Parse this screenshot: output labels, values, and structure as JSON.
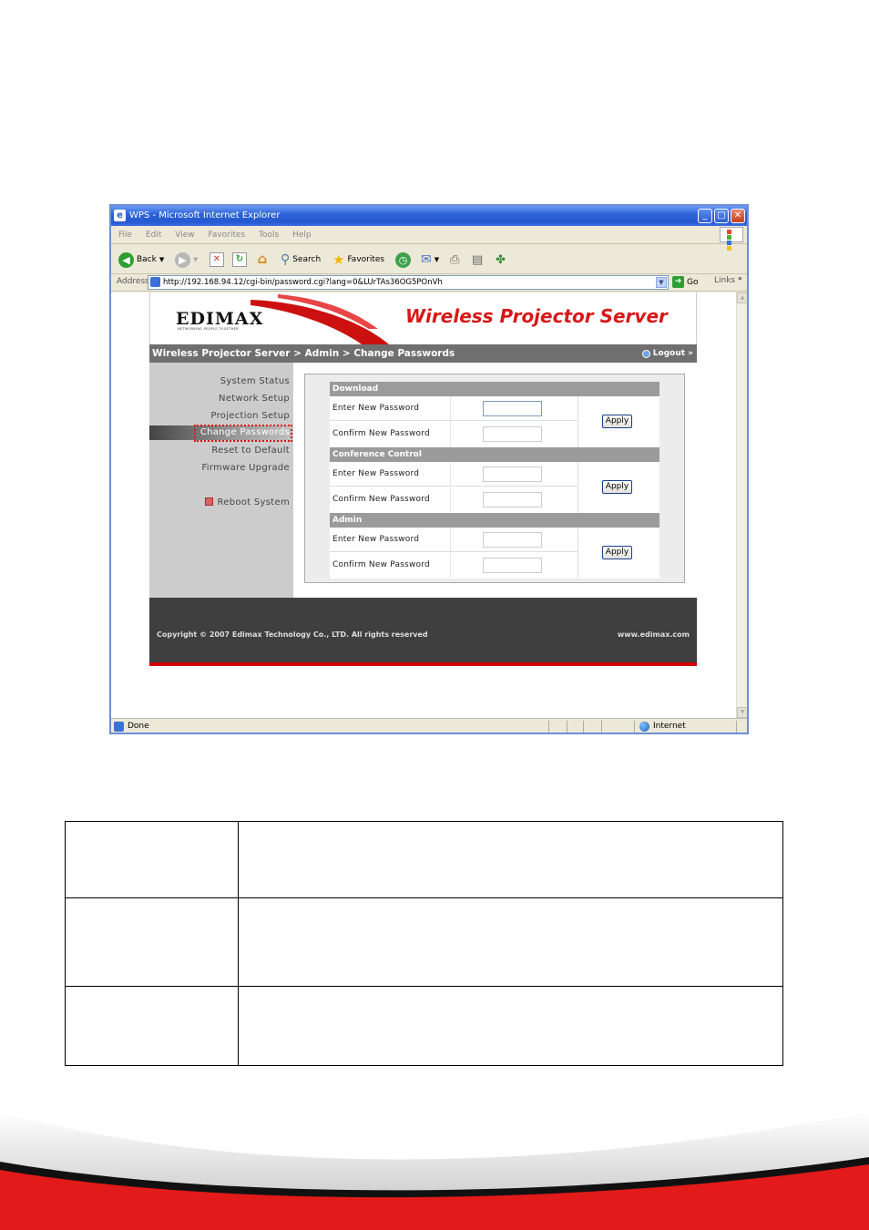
{
  "window": {
    "title": "WPS - Microsoft Internet Explorer",
    "controls": {
      "minimize": "_",
      "maximize": "□",
      "close": "✕"
    }
  },
  "menu": [
    "File",
    "Edit",
    "View",
    "Favorites",
    "Tools",
    "Help"
  ],
  "toolbar": {
    "back": "Back",
    "search": "Search",
    "favorites": "Favorites"
  },
  "address": {
    "label": "Address",
    "url": "http://192.168.94.12/cgi-bin/password.cgi?lang=0&LUrTAs36OG5POnVh",
    "go": "Go",
    "links": "Links"
  },
  "status": {
    "text": "Done",
    "zone": "Internet"
  },
  "webpage": {
    "logo": "EDIMAX",
    "logo_tagline": "NETWORKING PEOPLE TOGETHER",
    "product_title": "Wireless Projector Server",
    "breadcrumb": "Wireless Projector Server > Admin > Change Passwords",
    "logout": "Logout »",
    "sidebar": [
      "System Status",
      "Network Setup",
      "Projection Setup",
      "Change Passwords",
      "Reset to Default",
      "Firmware Upgrade",
      "Reboot System"
    ],
    "sections": [
      {
        "title": "Download",
        "row1": "Enter New Password",
        "row2": "Confirm New Password",
        "apply": "Apply"
      },
      {
        "title": "Conference Control",
        "row1": "Enter New Password",
        "row2": "Confirm New Password",
        "apply": "Apply"
      },
      {
        "title": "Admin",
        "row1": "Enter New Password",
        "row2": "Confirm New Password",
        "apply": "Apply"
      }
    ],
    "footer": {
      "copyright": "Copyright © 2007 Edimax Technology Co., LTD. All rights reserved",
      "site": "www.edimax.com"
    }
  },
  "colors": {
    "accent_red": "#d71818",
    "title_blue": "#2658d0",
    "nav_gray": "#6f6f6f"
  }
}
